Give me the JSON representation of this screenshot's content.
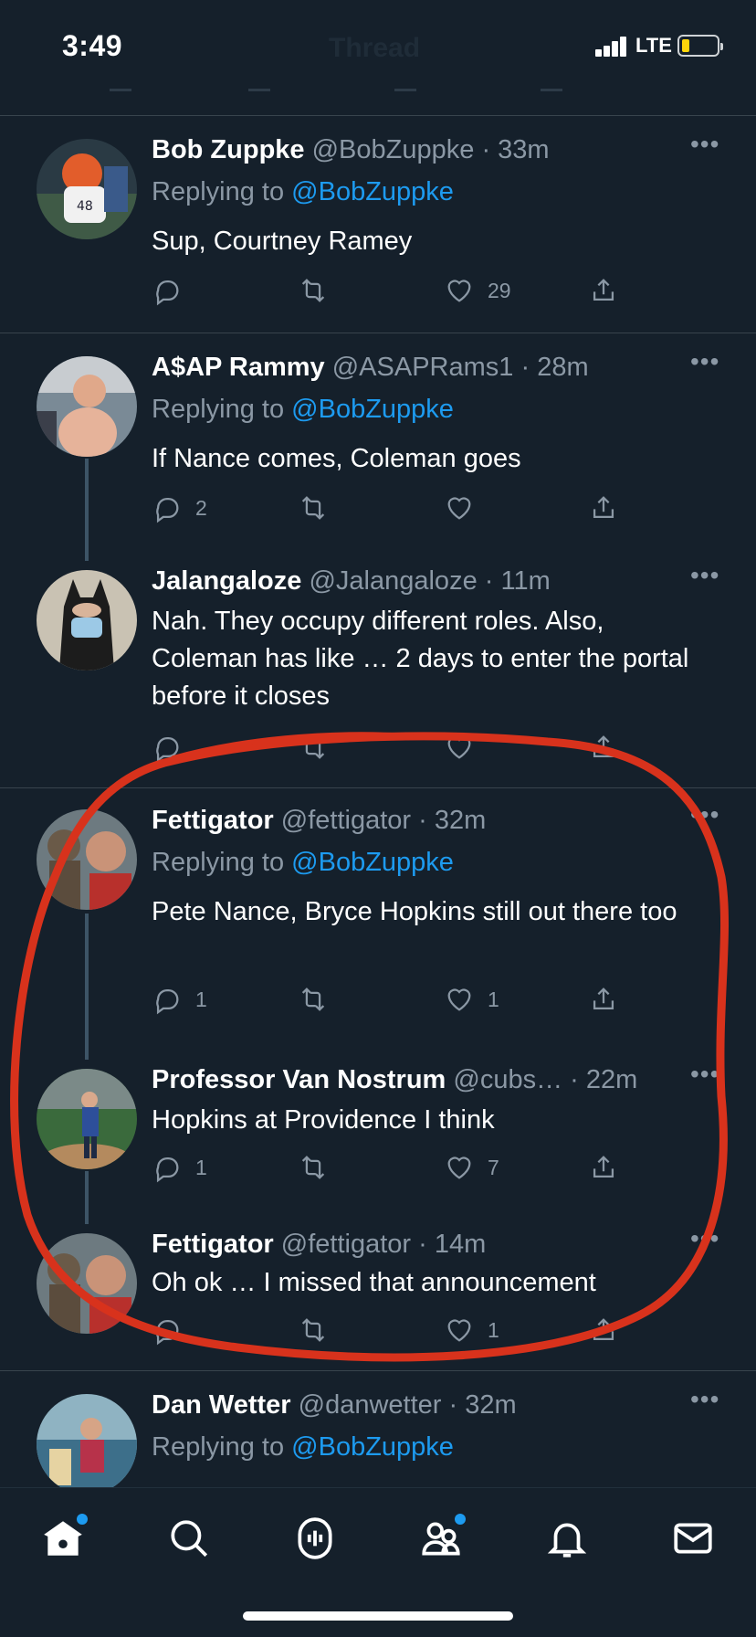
{
  "status": {
    "time": "3:49",
    "network": "LTE"
  },
  "header": {
    "title": "Thread"
  },
  "tweets": [
    {
      "name": "Bob Zuppke",
      "handle": "@BobZuppke",
      "sep": " · ",
      "time": "33m",
      "reply_prefix": "Replying to ",
      "reply_to": "@BobZuppke",
      "text": "Sup, Courtney Ramey",
      "reply_count": "",
      "retweet_count": "",
      "like_count": "29",
      "more": "•••"
    },
    {
      "name": "A$AP Rammy",
      "handle": "@ASAPRams1",
      "sep": " · ",
      "time": "28m",
      "reply_prefix": "Replying to ",
      "reply_to": "@BobZuppke",
      "text": "If Nance comes, Coleman goes",
      "reply_count": "2",
      "retweet_count": "",
      "like_count": "",
      "more": "•••"
    },
    {
      "name": "Jalangaloze",
      "handle": "@Jalangaloze",
      "sep": " · ",
      "time": "11m",
      "text": "Nah. They occupy different roles. Also, Coleman has like … 2 days to enter the portal before it closes",
      "reply_count": "",
      "retweet_count": "",
      "like_count": "",
      "more": "•••"
    },
    {
      "name": "Fettigator",
      "handle": "@fettigator",
      "sep": " · ",
      "time": "32m",
      "reply_prefix": "Replying to ",
      "reply_to": "@BobZuppke",
      "text": "Pete Nance, Bryce Hopkins still out there too",
      "reply_count": "1",
      "retweet_count": "",
      "like_count": "1",
      "more": "•••"
    },
    {
      "name": "Professor Van Nostrum",
      "handle": "@cubs…",
      "sep": " · ",
      "time": "22m",
      "text": "Hopkins at Providence I think",
      "reply_count": "1",
      "retweet_count": "",
      "like_count": "7",
      "more": "•••"
    },
    {
      "name": "Fettigator",
      "handle": "@fettigator",
      "sep": " · ",
      "time": "14m",
      "text": "Oh ok … I missed that announcement",
      "reply_count": "",
      "retweet_count": "",
      "like_count": "1",
      "more": "•••"
    },
    {
      "name": "Dan Wetter",
      "handle": "@danwetter",
      "sep": " · ",
      "time": "32m",
      "reply_prefix": "Replying to ",
      "reply_to": "@BobZuppke",
      "more": "•••"
    }
  ],
  "tabs": [
    "home",
    "search",
    "spaces",
    "communities",
    "notifications",
    "messages"
  ],
  "colors": {
    "background": "#15202b",
    "accent": "#1d9bf0",
    "muted": "#8b98a5",
    "annotation": "#d8321c",
    "battery": "#ffd60a"
  }
}
